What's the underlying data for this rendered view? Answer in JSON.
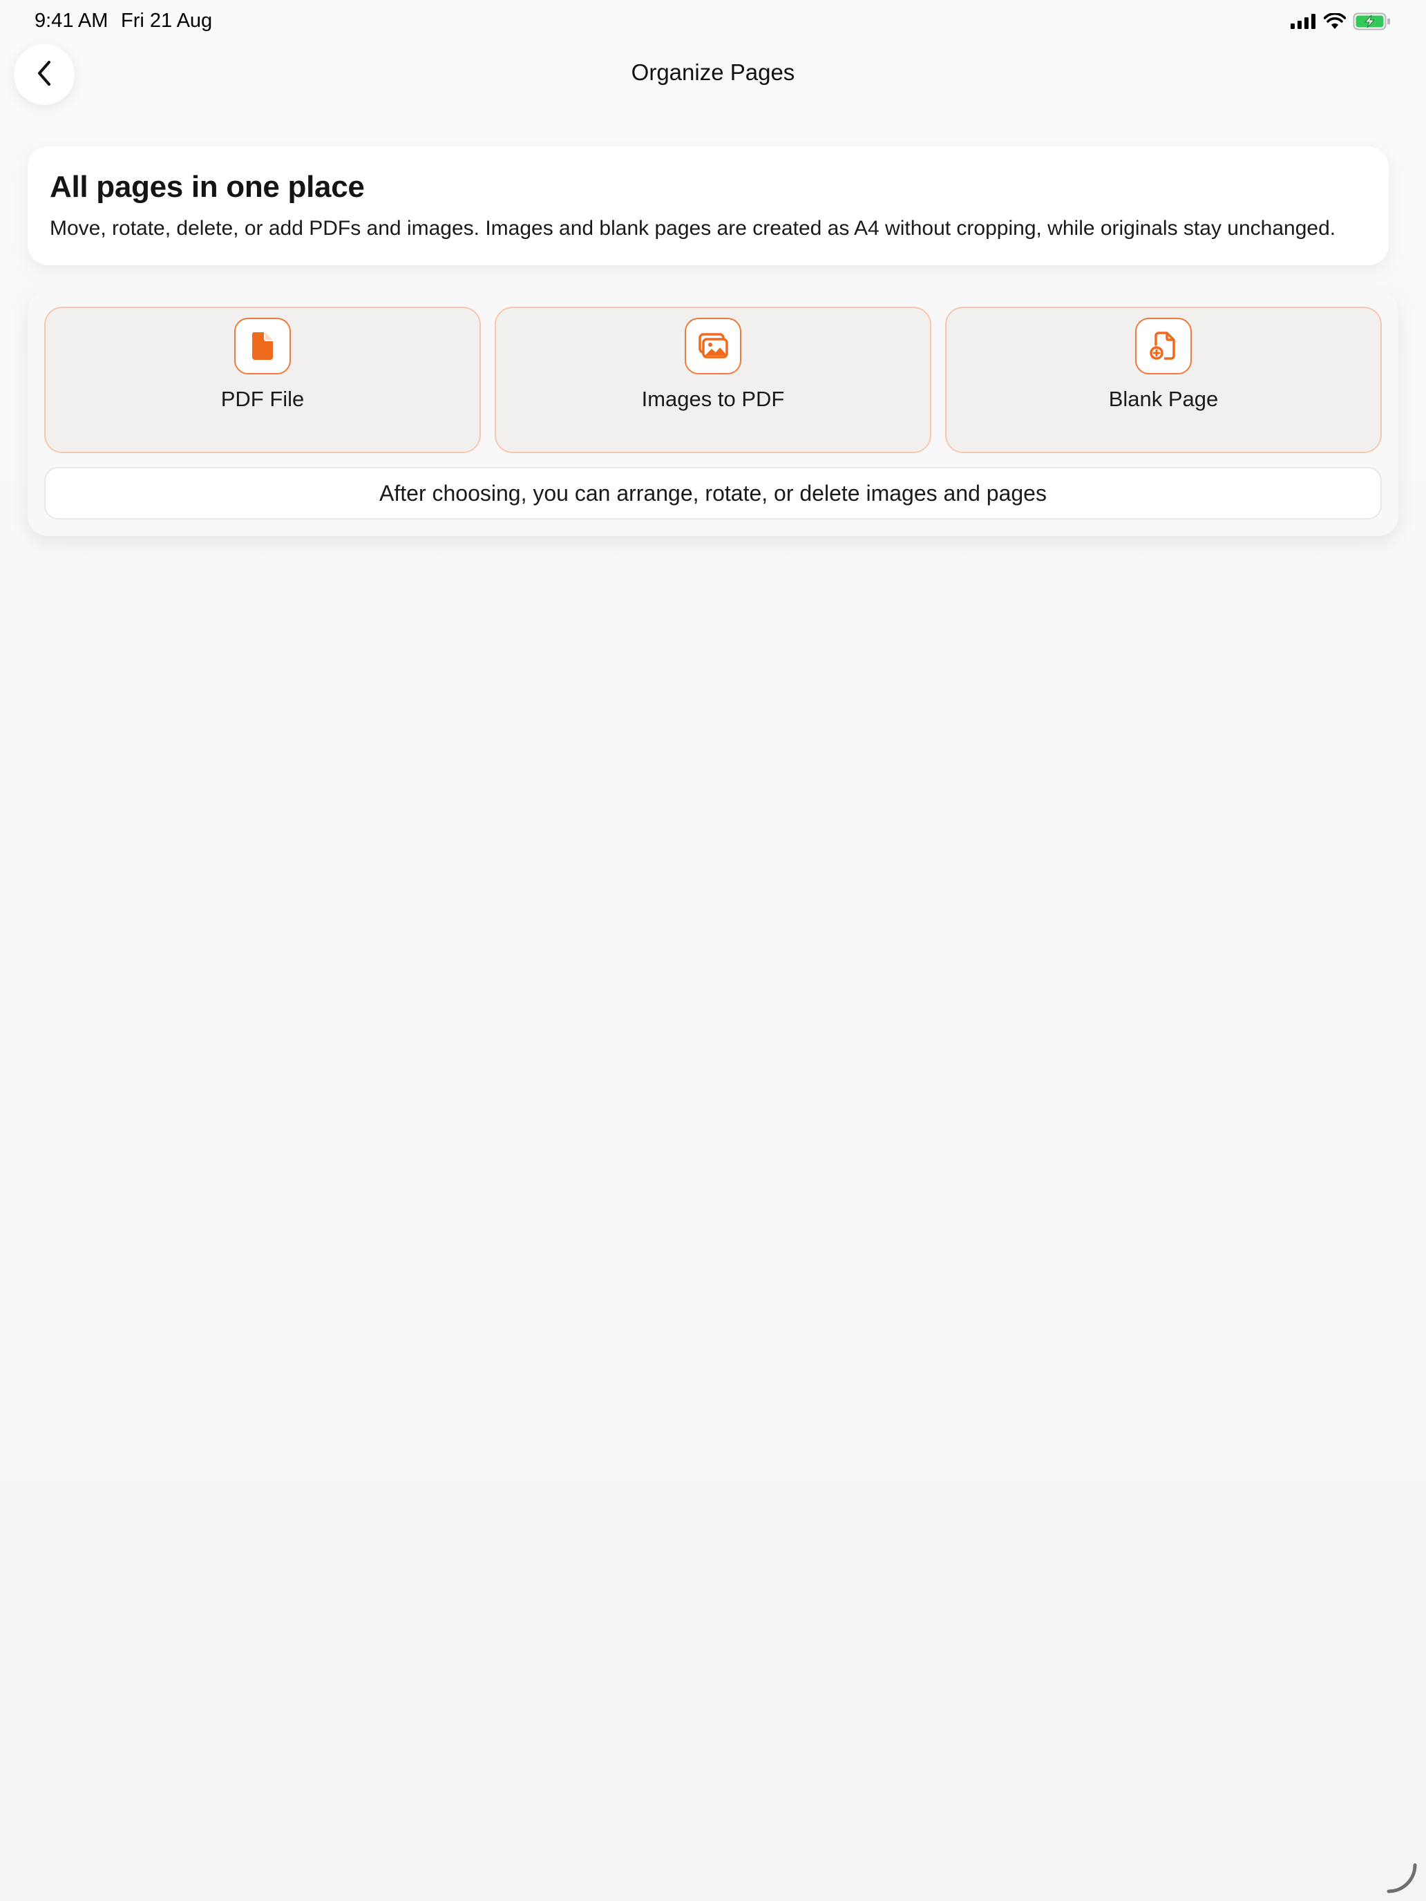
{
  "status_bar": {
    "time": "9:41 AM",
    "date": "Fri 21 Aug",
    "icons": [
      "signal-icon",
      "wifi-icon",
      "battery-charging-icon"
    ]
  },
  "nav": {
    "back_icon": "chevron-left-icon",
    "title": "Organize Pages"
  },
  "intro": {
    "title": "All pages in one place",
    "description": "Move, rotate, delete, or add PDFs and images. Images and blank pages are created as A4 without cropping, while originals stay unchanged."
  },
  "options": [
    {
      "label": "PDF File",
      "icon": "pdf-file-icon"
    },
    {
      "label": "Images to PDF",
      "icon": "images-icon"
    },
    {
      "label": "Blank Page",
      "icon": "blank-page-add-icon"
    }
  ],
  "hint": "After choosing, you can arrange, rotate, or delete images and pages",
  "colors": {
    "accent": "#f06a1e",
    "tile_border": "#f6c6ae",
    "tile_bg": "#f2f0ee",
    "battery": "#34c759"
  }
}
